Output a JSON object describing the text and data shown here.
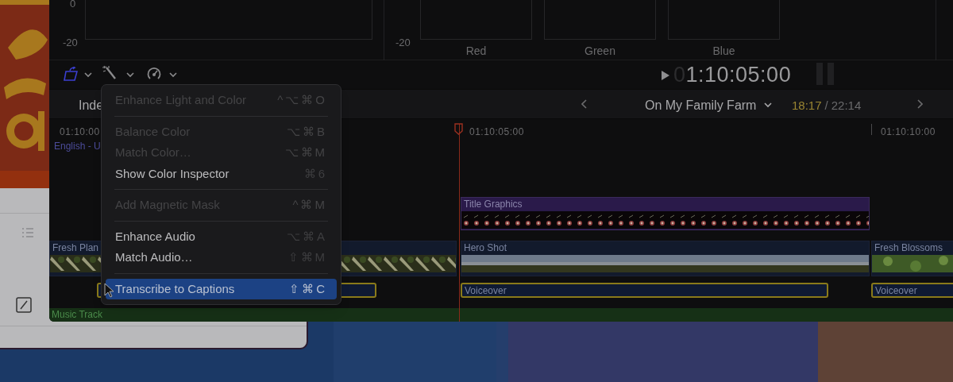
{
  "scopes": {
    "scale_labels": [
      "0",
      "-20",
      "-20"
    ],
    "channels": [
      "Red",
      "Green",
      "Blue"
    ]
  },
  "viewer": {
    "timecode_leading": "0",
    "timecode": "1:10:05:00"
  },
  "timeline_header": {
    "index_button": "Inde",
    "project": "On My Family Farm",
    "position": "18:17",
    "separator": "/",
    "duration": "22:14"
  },
  "ruler": [
    "01:10:00",
    "01:10:05:00",
    "01:10:10:00"
  ],
  "caption_lane": "English - U",
  "clips": [
    {
      "kind": "title",
      "label": "Title Graphics"
    },
    {
      "kind": "video",
      "label": "Fresh Plan"
    },
    {
      "kind": "video",
      "label": "Hero Shot"
    },
    {
      "kind": "video",
      "label": "Fresh Blossoms"
    },
    {
      "kind": "voice"
    },
    {
      "kind": "voice",
      "label": "Voiceover"
    },
    {
      "kind": "voice",
      "label": "Voiceover"
    },
    {
      "kind": "music",
      "label": "Music Track"
    }
  ],
  "menu": [
    {
      "kind": "item",
      "label": "Enhance Light and Color",
      "shortcut": "^⌥⌘O",
      "disabled": true,
      "selected": false
    },
    {
      "kind": "separator"
    },
    {
      "kind": "item",
      "label": "Balance Color",
      "shortcut": "⌥⌘B",
      "disabled": true,
      "selected": false
    },
    {
      "kind": "item",
      "label": "Match Color…",
      "shortcut": "⌥⌘M",
      "disabled": true,
      "selected": false
    },
    {
      "kind": "item",
      "label": "Show Color Inspector",
      "shortcut": "⌘6",
      "disabled": false,
      "selected": false
    },
    {
      "kind": "separator"
    },
    {
      "kind": "item",
      "label": "Add Magnetic Mask",
      "shortcut": "^⌘M",
      "disabled": true,
      "selected": false
    },
    {
      "kind": "separator"
    },
    {
      "kind": "item",
      "label": "Enhance Audio",
      "shortcut": "⌥⌘A",
      "disabled": false,
      "selected": false
    },
    {
      "kind": "item",
      "label": "Match Audio…",
      "shortcut": "⇧⌘M",
      "disabled": false,
      "selected": false
    },
    {
      "kind": "separator"
    },
    {
      "kind": "item",
      "label": "Transcribe to Captions",
      "shortcut": "⇧⌘C",
      "disabled": false,
      "selected": true
    }
  ]
}
